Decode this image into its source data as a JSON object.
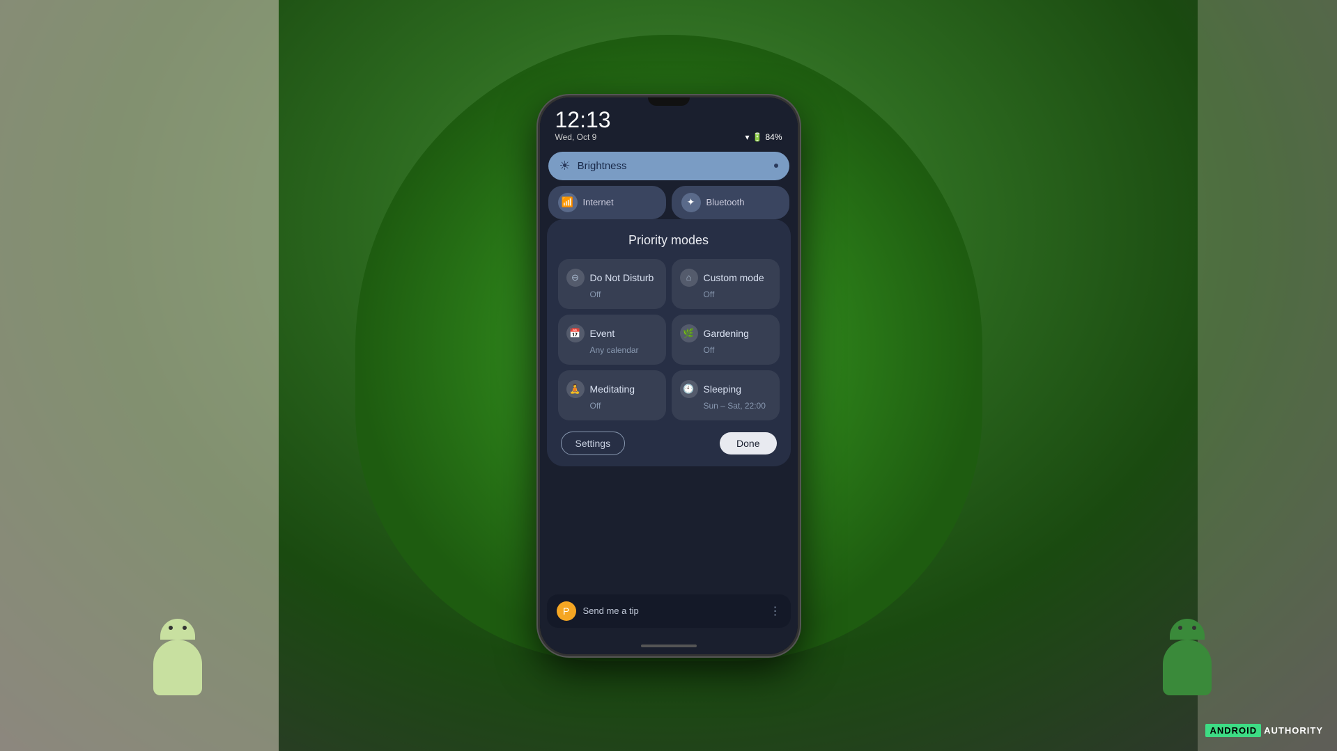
{
  "background": {
    "color": "#2a4a1a"
  },
  "phone": {
    "status_bar": {
      "time": "12:13",
      "date": "Wed, Oct 9",
      "battery": "84%",
      "wifi_icon": "wifi",
      "battery_icon": "battery"
    },
    "quick_settings": {
      "brightness": {
        "label": "Brightness",
        "icon": "☀"
      },
      "internet": {
        "label": "Internet"
      },
      "bluetooth": {
        "label": "Bluetooth"
      }
    },
    "priority_modes": {
      "title": "Priority modes",
      "modes": [
        {
          "name": "Do Not Disturb",
          "status": "Off",
          "icon": "⊖"
        },
        {
          "name": "Custom mode",
          "status": "Off",
          "icon": "⌂"
        },
        {
          "name": "Event",
          "status": "Any calendar",
          "icon": "📅"
        },
        {
          "name": "Gardening",
          "status": "Off",
          "icon": "🌿"
        },
        {
          "name": "Meditating",
          "status": "Off",
          "icon": "🧘"
        },
        {
          "name": "Sleeping",
          "status": "Sun – Sat, 22:00",
          "icon": "🕙"
        }
      ],
      "buttons": {
        "settings": "Settings",
        "done": "Done"
      }
    },
    "tip_bar": {
      "text": "Send me a tip",
      "icon": "P"
    }
  },
  "branding": {
    "android": "ANDROID",
    "authority": "AUTHORITY"
  }
}
